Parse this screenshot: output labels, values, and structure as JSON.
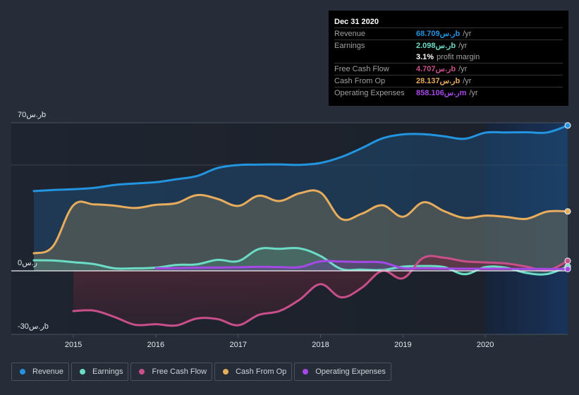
{
  "tooltip": {
    "date": "Dec 31 2020",
    "rows": [
      {
        "label": "Revenue",
        "value": "68.709ر.سb",
        "unit": "/yr",
        "color": "#2394df"
      },
      {
        "label": "Earnings",
        "value": "2.098ر.سb",
        "unit": "/yr",
        "color": "#6cdcc6"
      },
      {
        "label": "",
        "value": "3.1%",
        "unit": "profit margin",
        "color": "#ffffff"
      },
      {
        "label": "Free Cash Flow",
        "value": "4.707ر.سb",
        "unit": "/yr",
        "color": "#c94f8a"
      },
      {
        "label": "Cash From Op",
        "value": "28.137ر.سb",
        "unit": "/yr",
        "color": "#e8ac5d"
      },
      {
        "label": "Operating Expenses",
        "value": "858.106ر.سm",
        "unit": "/yr",
        "color": "#a449e6"
      }
    ]
  },
  "legend": [
    {
      "label": "Revenue",
      "color": "#2394df"
    },
    {
      "label": "Earnings",
      "color": "#6cdcc6"
    },
    {
      "label": "Free Cash Flow",
      "color": "#c94f8a"
    },
    {
      "label": "Cash From Op",
      "color": "#e8ac5d"
    },
    {
      "label": "Operating Expenses",
      "color": "#a449e6"
    }
  ],
  "chart_data": {
    "type": "area",
    "title": "",
    "xlabel": "",
    "ylabel": "",
    "x_ticks": [
      "2015",
      "2016",
      "2017",
      "2018",
      "2019",
      "2020"
    ],
    "y_ticks": [
      {
        "value": 70,
        "label": "70ر.سb"
      },
      {
        "value": 0,
        "label": "0ر.س"
      },
      {
        "value": -30,
        "label": "-30ر.سb"
      }
    ],
    "xlim": [
      2014.52,
      2021.0
    ],
    "ylim": [
      -30,
      70
    ],
    "highlight_from": 2020.0,
    "grid": true,
    "legend_position": "bottom-left",
    "series": [
      {
        "name": "Revenue",
        "color": "#2394df",
        "points": [
          [
            2014.52,
            37.7
          ],
          [
            2014.75,
            38.2
          ],
          [
            2015.0,
            38.6
          ],
          [
            2015.25,
            39.2
          ],
          [
            2015.5,
            40.6
          ],
          [
            2015.75,
            41.3
          ],
          [
            2016.0,
            41.9
          ],
          [
            2016.25,
            43.3
          ],
          [
            2016.5,
            44.8
          ],
          [
            2016.75,
            48.6
          ],
          [
            2017.0,
            50.0
          ],
          [
            2017.25,
            50.2
          ],
          [
            2017.5,
            50.3
          ],
          [
            2017.75,
            50.1
          ],
          [
            2018.0,
            51.0
          ],
          [
            2018.25,
            53.8
          ],
          [
            2018.5,
            58.0
          ],
          [
            2018.75,
            62.6
          ],
          [
            2019.0,
            64.5
          ],
          [
            2019.25,
            64.6
          ],
          [
            2019.5,
            63.6
          ],
          [
            2019.75,
            62.4
          ],
          [
            2020.0,
            65.3
          ],
          [
            2020.25,
            65.4
          ],
          [
            2020.5,
            65.5
          ],
          [
            2020.75,
            65.4
          ],
          [
            2021.0,
            68.7
          ]
        ]
      },
      {
        "name": "Cash From Op",
        "color": "#e8ac5d",
        "points": [
          [
            2014.52,
            8.3
          ],
          [
            2014.75,
            11.5
          ],
          [
            2015.0,
            31.0
          ],
          [
            2015.25,
            31.4
          ],
          [
            2015.5,
            30.8
          ],
          [
            2015.75,
            29.7
          ],
          [
            2016.0,
            31.2
          ],
          [
            2016.25,
            32.0
          ],
          [
            2016.5,
            35.8
          ],
          [
            2016.75,
            34.0
          ],
          [
            2017.0,
            30.7
          ],
          [
            2017.25,
            35.5
          ],
          [
            2017.5,
            33.0
          ],
          [
            2017.75,
            36.7
          ],
          [
            2018.0,
            37.0
          ],
          [
            2018.25,
            24.6
          ],
          [
            2018.5,
            27.0
          ],
          [
            2018.75,
            31.0
          ],
          [
            2019.0,
            25.6
          ],
          [
            2019.25,
            32.4
          ],
          [
            2019.5,
            28.2
          ],
          [
            2019.75,
            25.0
          ],
          [
            2020.0,
            26.1
          ],
          [
            2020.25,
            25.5
          ],
          [
            2020.5,
            24.6
          ],
          [
            2020.75,
            28.0
          ],
          [
            2021.0,
            28.1
          ]
        ]
      },
      {
        "name": "Earnings",
        "color": "#6cdcc6",
        "points": [
          [
            2014.52,
            5.0
          ],
          [
            2014.75,
            4.9
          ],
          [
            2015.0,
            4.1
          ],
          [
            2015.25,
            3.2
          ],
          [
            2015.5,
            1.2
          ],
          [
            2015.75,
            1.2
          ],
          [
            2016.0,
            1.5
          ],
          [
            2016.25,
            2.8
          ],
          [
            2016.5,
            3.1
          ],
          [
            2016.75,
            5.2
          ],
          [
            2017.0,
            4.6
          ],
          [
            2017.25,
            10.3
          ],
          [
            2017.5,
            10.4
          ],
          [
            2017.75,
            10.6
          ],
          [
            2018.0,
            7.0
          ],
          [
            2018.25,
            0.9
          ],
          [
            2018.5,
            0.6
          ],
          [
            2018.75,
            0.4
          ],
          [
            2019.0,
            2.0
          ],
          [
            2019.25,
            2.3
          ],
          [
            2019.5,
            1.8
          ],
          [
            2019.75,
            -1.6
          ],
          [
            2020.0,
            1.8
          ],
          [
            2020.25,
            1.5
          ],
          [
            2020.5,
            -1.0
          ],
          [
            2020.75,
            -1.5
          ],
          [
            2021.0,
            2.1
          ]
        ]
      },
      {
        "name": "Free Cash Flow",
        "color": "#c94f8a",
        "points": [
          [
            2015.0,
            -19.0
          ],
          [
            2015.25,
            -18.8
          ],
          [
            2015.5,
            -21.8
          ],
          [
            2015.75,
            -25.5
          ],
          [
            2016.0,
            -25.2
          ],
          [
            2016.25,
            -25.8
          ],
          [
            2016.5,
            -22.5
          ],
          [
            2016.75,
            -22.8
          ],
          [
            2017.0,
            -25.7
          ],
          [
            2017.25,
            -20.8
          ],
          [
            2017.5,
            -19.0
          ],
          [
            2017.75,
            -13.5
          ],
          [
            2018.0,
            -6.3
          ],
          [
            2018.25,
            -12.5
          ],
          [
            2018.5,
            -8.0
          ],
          [
            2018.75,
            0.0
          ],
          [
            2019.0,
            -3.5
          ],
          [
            2019.25,
            6.2
          ],
          [
            2019.5,
            6.2
          ],
          [
            2019.75,
            4.5
          ],
          [
            2020.0,
            4.0
          ],
          [
            2020.25,
            3.5
          ],
          [
            2020.5,
            2.0
          ],
          [
            2020.75,
            0.2
          ],
          [
            2021.0,
            4.7
          ]
        ]
      },
      {
        "name": "Operating Expenses",
        "color": "#a449e6",
        "points": [
          [
            2016.0,
            1.2
          ],
          [
            2016.25,
            1.3
          ],
          [
            2016.5,
            1.5
          ],
          [
            2016.75,
            1.6
          ],
          [
            2017.0,
            1.7
          ],
          [
            2017.25,
            1.9
          ],
          [
            2017.5,
            1.8
          ],
          [
            2017.75,
            1.8
          ],
          [
            2018.0,
            4.5
          ],
          [
            2018.25,
            4.4
          ],
          [
            2018.5,
            4.2
          ],
          [
            2018.75,
            4.0
          ],
          [
            2019.0,
            1.3
          ],
          [
            2019.25,
            1.2
          ],
          [
            2019.5,
            1.1
          ],
          [
            2019.75,
            1.0
          ],
          [
            2020.0,
            1.0
          ],
          [
            2020.25,
            1.0
          ],
          [
            2020.5,
            0.9
          ],
          [
            2020.75,
            0.9
          ],
          [
            2021.0,
            0.86
          ]
        ]
      }
    ]
  }
}
